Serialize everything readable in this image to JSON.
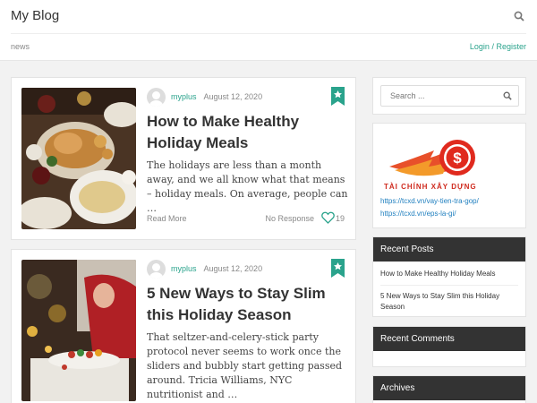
{
  "header": {
    "site_title": "My Blog",
    "nav": [
      "news"
    ],
    "login_label": "Login",
    "separator": "/",
    "register_label": "Register"
  },
  "posts": [
    {
      "author": "myplus",
      "date": "August 12, 2020",
      "title": "How to Make Healthy Holiday Meals",
      "excerpt": "The holidays are less than a month away, and we all know what that means – holiday meals. On average, people can …",
      "read_more": "Read More",
      "responses": "No Response",
      "likes": "19"
    },
    {
      "author": "myplus",
      "date": "August 12, 2020",
      "title": "5 New Ways to Stay Slim this Holiday Season",
      "excerpt": "That seltzer-and-celery-stick party protocol never seems to work once the sliders and bubbly start getting passed around. Tricia Williams, NYC nutritionist and …"
    }
  ],
  "sidebar": {
    "search_placeholder": "Search ...",
    "ad": {
      "brand": "TÀI CHÍNH XÂY DỰNG",
      "links": [
        "https://tcxd.vn/vay-tien-tra-gop/",
        "https://tcxd.vn/eps-la-gi/"
      ]
    },
    "recent_posts": {
      "title": "Recent Posts",
      "items": [
        "How to Make Healthy Holiday Meals",
        "5 New Ways to Stay Slim this Holiday Season"
      ]
    },
    "recent_comments": {
      "title": "Recent Comments"
    },
    "archives": {
      "title": "Archives"
    }
  },
  "colors": {
    "accent": "#2aa38c",
    "link": "#1f7fbf",
    "widget_header": "#333333",
    "brand_red": "#cf2a1e"
  }
}
